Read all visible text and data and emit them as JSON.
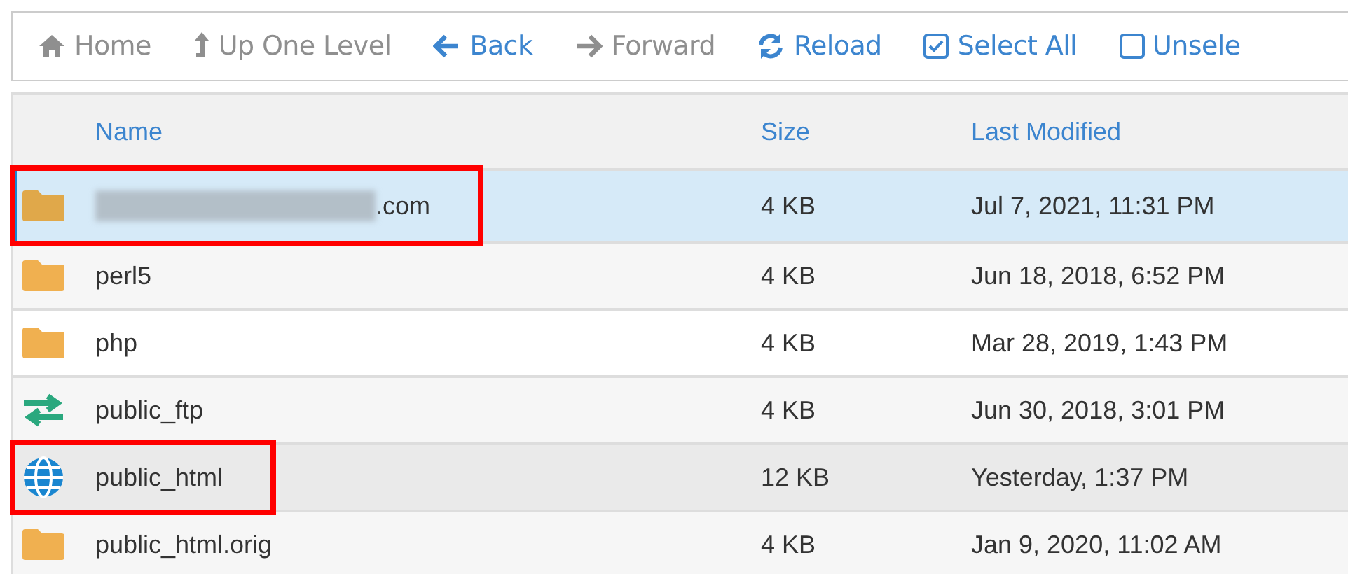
{
  "toolbar": [
    {
      "kind": "home",
      "label": "Home",
      "disabled": true
    },
    {
      "kind": "up",
      "label": "Up One Level",
      "disabled": true
    },
    {
      "kind": "back",
      "label": "Back",
      "disabled": false
    },
    {
      "kind": "forward",
      "label": "Forward",
      "disabled": true
    },
    {
      "kind": "reload",
      "label": "Reload",
      "disabled": false
    },
    {
      "kind": "check",
      "label": "Select All",
      "disabled": false
    },
    {
      "kind": "box",
      "label": "Unsele",
      "disabled": false
    }
  ],
  "table": {
    "columns": [
      "Name",
      "Size",
      "Last Modified"
    ],
    "rows": [
      {
        "kind": "folder",
        "name": ".com",
        "name_redacted": true,
        "size": "4 KB",
        "modified": "Jul 7, 2021, 11:31 PM",
        "selected": true,
        "hovered": false,
        "highlighted": true
      },
      {
        "kind": "folder",
        "name": "perl5",
        "name_redacted": false,
        "size": "4 KB",
        "modified": "Jun 18, 2018, 6:52 PM",
        "selected": false,
        "hovered": false,
        "highlighted": false
      },
      {
        "kind": "folder",
        "name": "php",
        "name_redacted": false,
        "size": "4 KB",
        "modified": "Mar 28, 2019, 1:43 PM",
        "selected": false,
        "hovered": false,
        "highlighted": false
      },
      {
        "kind": "transfer",
        "name": "public_ftp",
        "name_redacted": false,
        "size": "4 KB",
        "modified": "Jun 30, 2018, 3:01 PM",
        "selected": false,
        "hovered": false,
        "highlighted": false
      },
      {
        "kind": "globe",
        "name": "public_html",
        "name_redacted": false,
        "size": "12 KB",
        "modified": "Yesterday, 1:37 PM",
        "selected": false,
        "hovered": true,
        "highlighted": true
      },
      {
        "kind": "folder",
        "name": "public_html.orig",
        "name_redacted": false,
        "size": "4 KB",
        "modified": "Jan 9, 2020, 11:02 AM",
        "selected": false,
        "hovered": false,
        "highlighted": false
      }
    ]
  }
}
